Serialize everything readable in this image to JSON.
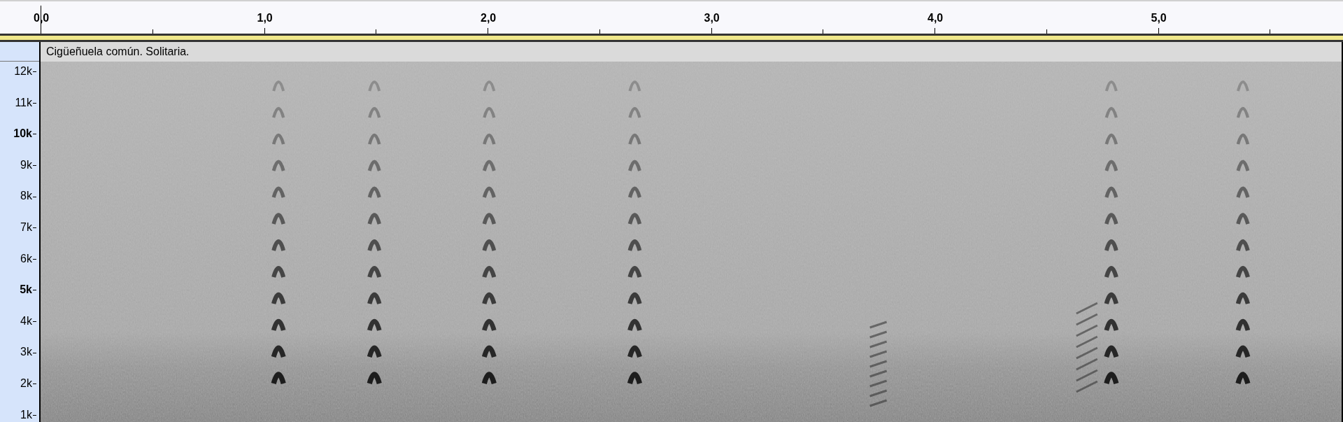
{
  "time_ruler": {
    "labels": [
      "0,0",
      "1,0",
      "2,0",
      "3,0",
      "4,0",
      "5,0"
    ]
  },
  "label_track": {
    "label": "Cigüeñuela común. Solitaria."
  },
  "frequency_axis": {
    "labels": [
      {
        "text": "12k",
        "emphasized": false
      },
      {
        "text": "11k",
        "emphasized": false
      },
      {
        "text": "10k",
        "emphasized": true
      },
      {
        "text": "9k",
        "emphasized": false
      },
      {
        "text": "8k",
        "emphasized": false
      },
      {
        "text": "7k",
        "emphasized": false
      },
      {
        "text": "6k",
        "emphasized": false
      },
      {
        "text": "5k",
        "emphasized": true
      },
      {
        "text": "4k",
        "emphasized": false
      },
      {
        "text": "3k",
        "emphasized": false
      },
      {
        "text": "2k",
        "emphasized": false
      },
      {
        "text": "1k",
        "emphasized": false
      }
    ]
  }
}
